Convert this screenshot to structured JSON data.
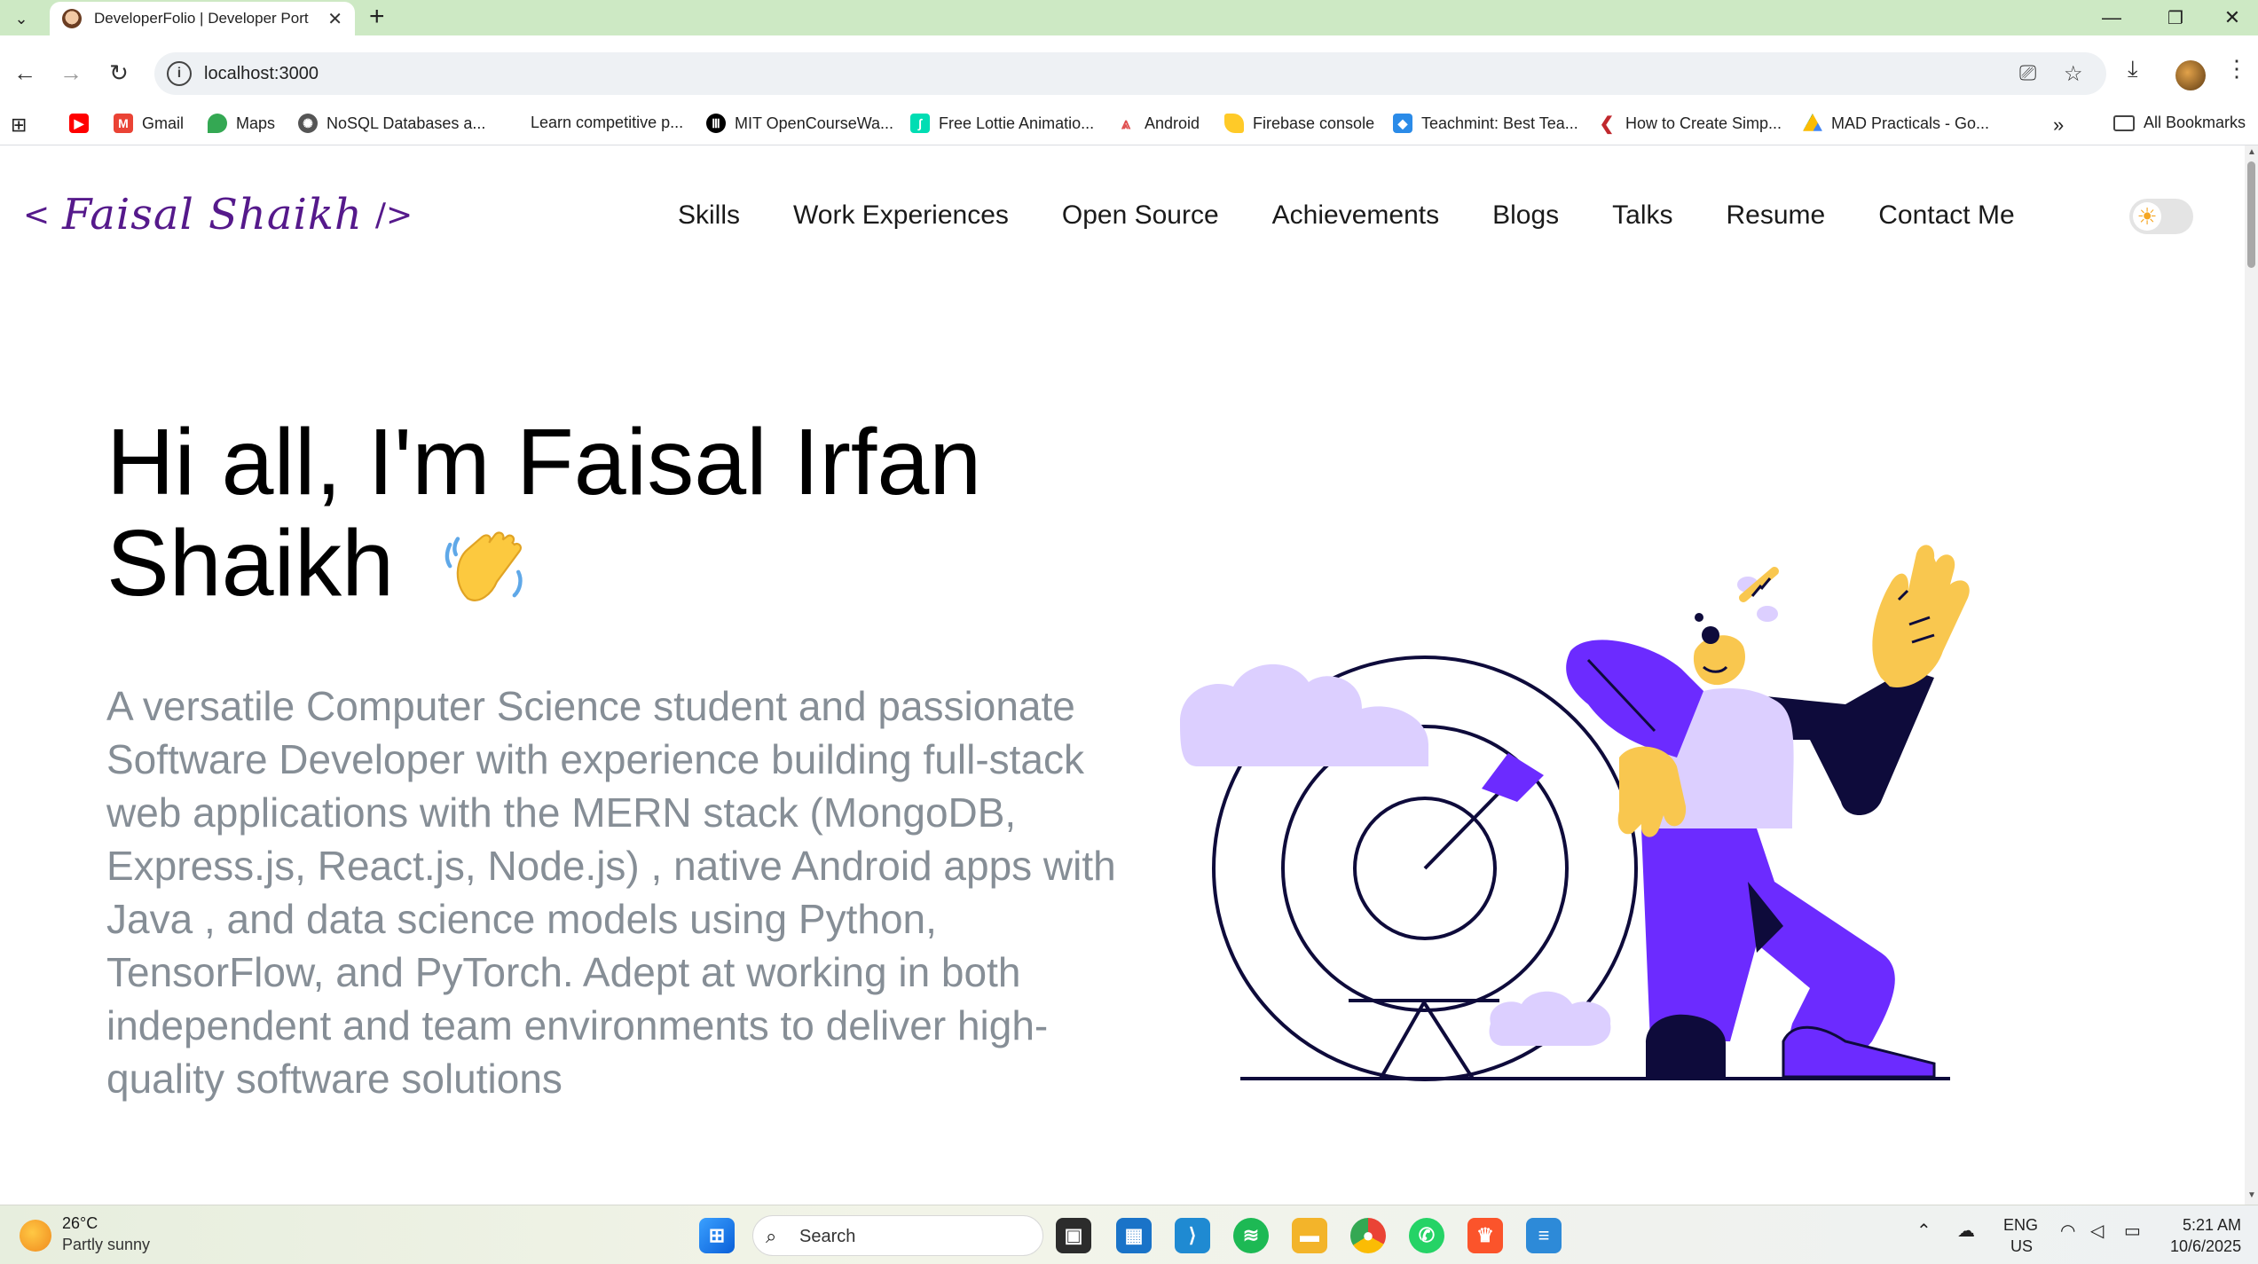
{
  "browser": {
    "tab_title": "DeveloperFolio | Developer Port",
    "url": "localhost:3000",
    "bookmarks": [
      {
        "label": "Gmail",
        "icon": "gmail-icon"
      },
      {
        "label": "Maps",
        "icon": "maps-icon"
      },
      {
        "label": "NoSQL Databases a...",
        "icon": "nosql-icon"
      },
      {
        "label": "Learn competitive p...",
        "icon": "none"
      },
      {
        "label": "MIT OpenCourseWa...",
        "icon": "mit-icon"
      },
      {
        "label": "Free Lottie Animatio...",
        "icon": "lottie-icon"
      },
      {
        "label": "Android",
        "icon": "android-icon"
      },
      {
        "label": "Firebase console",
        "icon": "firebase-icon"
      },
      {
        "label": "Teachmint: Best Tea...",
        "icon": "teachmint-icon"
      },
      {
        "label": "How to Create Simp...",
        "icon": "chevron-icon"
      },
      {
        "label": "MAD Practicals - Go...",
        "icon": "drive-icon"
      }
    ],
    "all_bookmarks": "All Bookmarks"
  },
  "site": {
    "logo_open": "<",
    "logo_name": "Faisal Shaikh",
    "logo_close": "/>",
    "nav": [
      "Skills",
      "Work Experiences",
      "Open Source",
      "Achievements",
      "Blogs",
      "Talks",
      "Resume",
      "Contact Me"
    ],
    "greeting_line": "Hi all, I'm Faisal Irfan Shaikh",
    "subtitle": "A versatile Computer Science student and passionate Software Developer with experience building full-stack web applications with the MERN stack (MongoDB, Express.js, React.js, Node.js) , native Android apps with Java , and data science models using Python, TensorFlow, and PyTorch. Adept at working in both independent and team environments to deliver high-quality software solutions"
  },
  "taskbar": {
    "temperature": "26°C",
    "weather": "Partly sunny",
    "search_label": "Search",
    "lang": "ENG",
    "region": "US",
    "time": "5:21 AM",
    "date": "10/6/2025"
  },
  "colors": {
    "accent": "#55198b",
    "hero_purple": "#6c2bff",
    "hero_lilac": "#dccfff",
    "hero_yellow": "#f9c74f",
    "hero_navy": "#0e0b3b",
    "subtitle_gray": "#868e96"
  }
}
